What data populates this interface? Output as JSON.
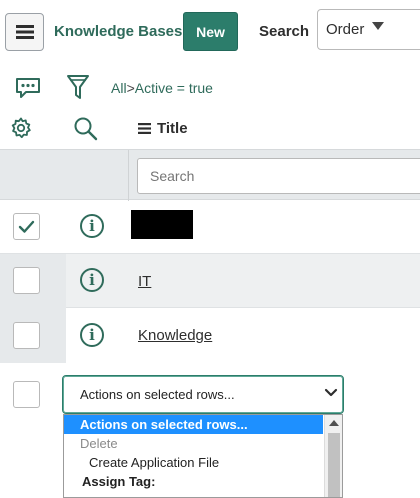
{
  "header": {
    "title": "Knowledge Bases",
    "new_label": "New",
    "search_label": "Search",
    "order_value": "Order"
  },
  "filter": {
    "all": "All",
    "separator": ">",
    "condition": "Active = true"
  },
  "columns": {
    "title": "Title"
  },
  "search": {
    "placeholder": "Search"
  },
  "rows": [
    {
      "title": "",
      "checked": true,
      "redacted": true
    },
    {
      "title": "IT",
      "checked": false
    },
    {
      "title": "Knowledge",
      "checked": false
    }
  ],
  "actions": {
    "selected": "Actions on selected rows...",
    "options": [
      "Actions on selected rows...",
      "Delete",
      "Create Application File",
      "Assign Tag:"
    ]
  },
  "icons": {
    "menu": "hamburger-icon",
    "chat": "chat-bubble-icon",
    "filter": "funnel-icon",
    "gear": "gear-icon",
    "search": "magnifier-icon",
    "info": "info-circle-icon"
  },
  "colors": {
    "accent": "#2c7d6b",
    "link": "#2f6b5b",
    "selection": "#1e90ff"
  }
}
